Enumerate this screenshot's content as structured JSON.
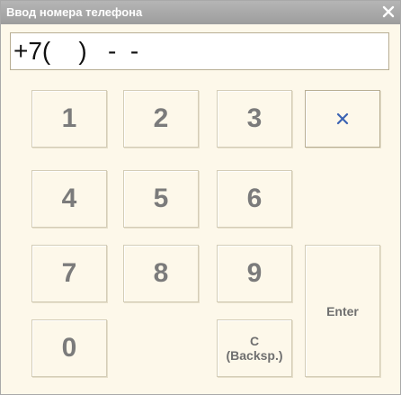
{
  "window": {
    "title": "Ввод номера телефона",
    "close_icon": "close-icon"
  },
  "display": {
    "value": "+7(    )   -  -"
  },
  "keypad": {
    "key_1": "1",
    "key_2": "2",
    "key_3": "3",
    "key_4": "4",
    "key_5": "5",
    "key_6": "6",
    "key_7": "7",
    "key_8": "8",
    "key_9": "9",
    "key_0": "0",
    "clear_icon": "clear-x-icon",
    "backspace_line1": "C",
    "backspace_line2": "(Backsp.)",
    "enter": "Enter"
  },
  "colors": {
    "window_bg": "#fdf8ea",
    "titlebar": "#a9a9a9",
    "clear_icon": "#3b63b3"
  }
}
